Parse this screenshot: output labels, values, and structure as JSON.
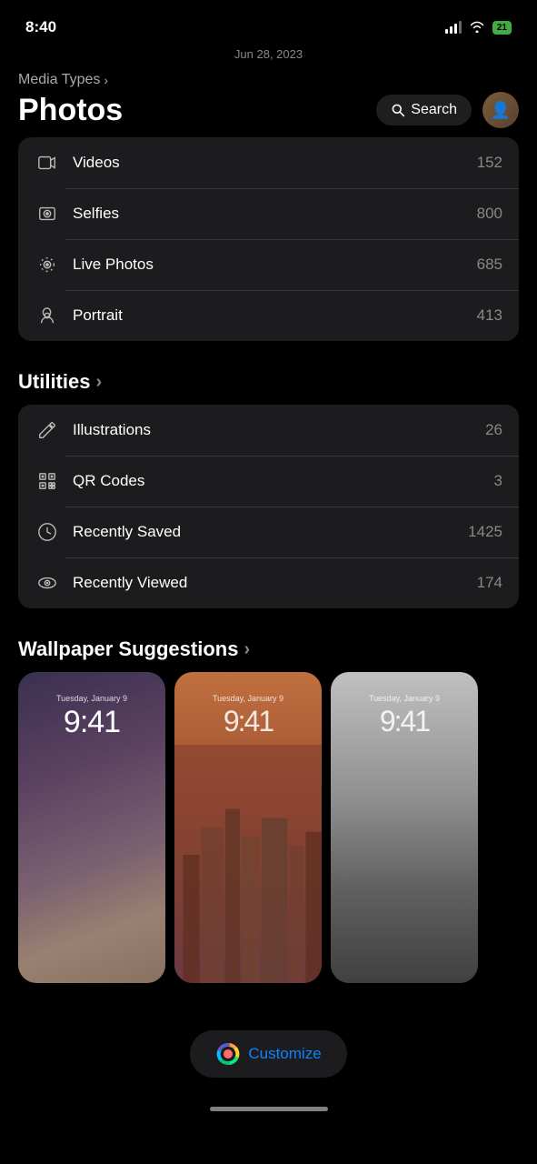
{
  "status": {
    "time": "8:40",
    "battery": "21"
  },
  "header": {
    "breadcrumb": "Media Types",
    "title": "Photos",
    "search_label": "Search"
  },
  "date_separator": "Jun 28, 2023",
  "media_types_section": {
    "items": [
      {
        "id": "videos",
        "label": "Videos",
        "count": "152",
        "icon": "video"
      },
      {
        "id": "selfies",
        "label": "Selfies",
        "count": "800",
        "icon": "selfie"
      },
      {
        "id": "live-photos",
        "label": "Live Photos",
        "count": "685",
        "icon": "live"
      },
      {
        "id": "portrait",
        "label": "Portrait",
        "count": "413",
        "icon": "portrait"
      }
    ]
  },
  "utilities_section": {
    "heading": "Utilities",
    "items": [
      {
        "id": "illustrations",
        "label": "Illustrations",
        "count": "26",
        "icon": "pencil"
      },
      {
        "id": "qr-codes",
        "label": "QR Codes",
        "count": "3",
        "icon": "qr"
      },
      {
        "id": "recently-saved",
        "label": "Recently Saved",
        "count": "1425",
        "icon": "download"
      },
      {
        "id": "recently-viewed",
        "label": "Recently Viewed",
        "count": "174",
        "icon": "eye"
      }
    ]
  },
  "wallpaper_section": {
    "heading": "Wallpaper Suggestions",
    "wallpapers": [
      {
        "id": "wp1",
        "date": "Tuesday, January 9",
        "time": "9:41"
      },
      {
        "id": "wp2",
        "date": "Tuesday, January 9",
        "time": "9:41"
      },
      {
        "id": "wp3",
        "date": "Tuesday, January 9",
        "time": "9:41"
      }
    ]
  },
  "customize": {
    "label": "Customize"
  }
}
